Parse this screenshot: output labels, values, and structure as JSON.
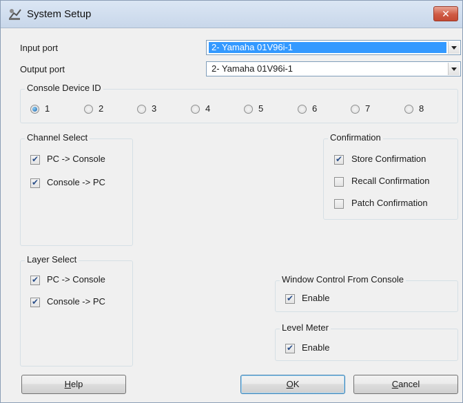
{
  "window": {
    "title": "System Setup",
    "close_glyph": "✕"
  },
  "input_port": {
    "label": "Input port",
    "value": "2- Yamaha 01V96i-1"
  },
  "output_port": {
    "label": "Output port",
    "value": "2- Yamaha 01V96i-1"
  },
  "console_device_id": {
    "legend": "Console Device ID",
    "options": [
      "1",
      "2",
      "3",
      "4",
      "5",
      "6",
      "7",
      "8"
    ],
    "selected": "1"
  },
  "channel_select": {
    "legend": "Channel Select",
    "items": [
      {
        "label": "PC -> Console",
        "checked": true
      },
      {
        "label": "Console -> PC",
        "checked": true
      }
    ]
  },
  "confirmation": {
    "legend": "Confirmation",
    "items": [
      {
        "label": "Store Confirmation",
        "checked": true
      },
      {
        "label": "Recall Confirmation",
        "checked": false
      },
      {
        "label": "Patch Confirmation",
        "checked": false
      }
    ]
  },
  "layer_select": {
    "legend": "Layer Select",
    "items": [
      {
        "label": "PC -> Console",
        "checked": true
      },
      {
        "label": "Console -> PC",
        "checked": true
      }
    ]
  },
  "window_control": {
    "legend": "Window Control From Console",
    "items": [
      {
        "label": "Enable",
        "checked": true
      }
    ]
  },
  "level_meter": {
    "legend": "Level Meter",
    "items": [
      {
        "label": "Enable",
        "checked": true
      }
    ]
  },
  "buttons": {
    "help": {
      "first": "H",
      "rest": "elp"
    },
    "ok": {
      "first": "O",
      "rest": "K"
    },
    "cancel": {
      "first": "C",
      "rest": "ancel"
    }
  }
}
